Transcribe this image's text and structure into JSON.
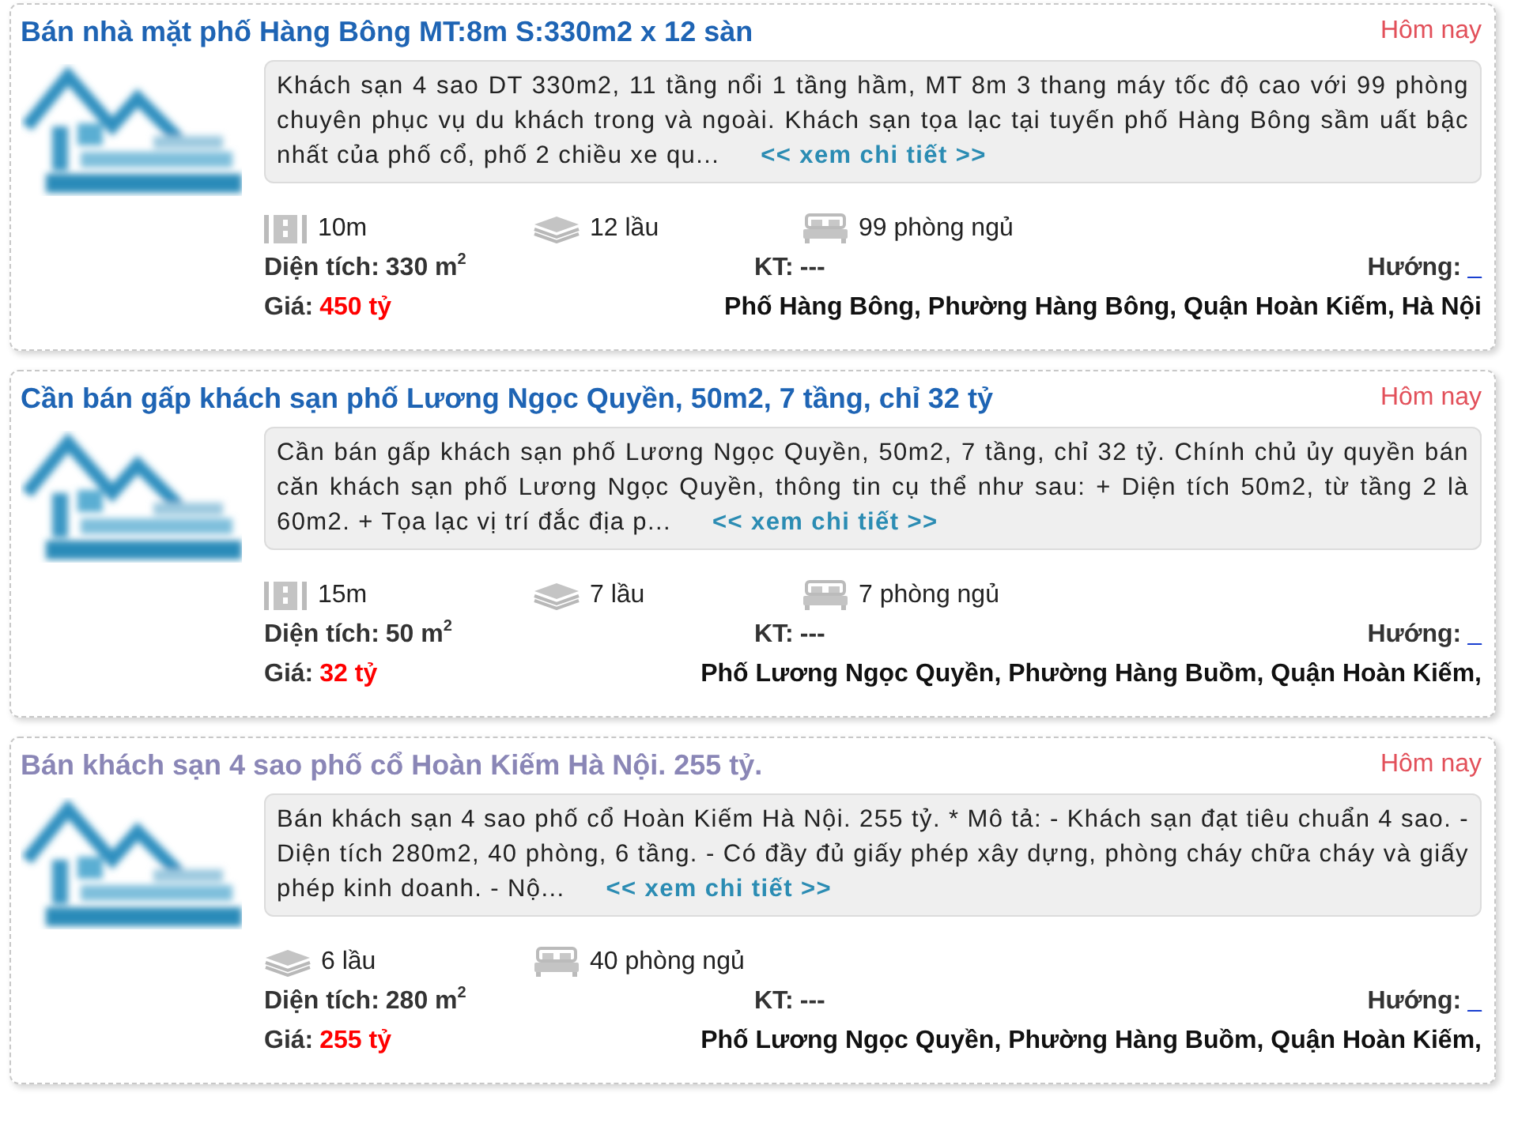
{
  "listings": [
    {
      "title": "Bán nhà mặt phố Hàng Bông MT:8m S:330m2 x 12 sàn",
      "visited": false,
      "date": "Hôm nay",
      "picture": {
        "kind": "picture"
      },
      "description": "Khách sạn 4 sao DT 330m2, 11 tầng nổi 1 tầng hầm, MT 8m 3 thang máy tốc độ cao với 99 phòng chuyên phục vụ du khách trong và ngoài. Khách sạn tọa lạc tại tuyến phố Hàng Bông sầm uất bậc nhất của phố cổ, phố 2 chiều xe qu...",
      "more_link": "<< xem chi tiết >>",
      "facts": [
        {
          "kind": "frontage",
          "text": "10m"
        },
        {
          "kind": "floors",
          "text": "12 lầu"
        },
        {
          "kind": "bedrooms",
          "text": "99 phòng ngủ"
        }
      ],
      "area_label": "Diện tích:",
      "area": "330 m$^{2}$",
      "kt_label": "KT:",
      "kt": "---",
      "direction_label": "Hướng:",
      "direction": "_",
      "price_label": "Giá:",
      "price": "450 tỷ",
      "address": "Phố Hàng Bông, Phường Hàng Bông, Quận Hoàn Kiếm, Hà Nội"
    },
    {
      "title": "Cần bán gấp khách sạn phố Lương Ngọc Quyền, 50m2, 7 tầng, chỉ 32 tỷ",
      "visited": false,
      "date": "Hôm nay",
      "picture": {
        "kind": "picture"
      },
      "description": "Cần bán gấp khách sạn phố Lương Ngọc Quyền, 50m2, 7 tầng, chỉ 32 tỷ. Chính chủ ủy quyền bán căn khách sạn phố Lương Ngọc Quyền, thông tin cụ thể như sau: + Diện tích 50m2, từ tầng 2 là 60m2. + Tọa lạc vị trí đắc địa p...",
      "more_link": "<< xem chi tiết >>",
      "facts": [
        {
          "kind": "frontage",
          "text": "15m"
        },
        {
          "kind": "floors",
          "text": "7 lầu"
        },
        {
          "kind": "bedrooms",
          "text": "7 phòng ngủ"
        }
      ],
      "area_label": "Diện tích:",
      "area": "50 m$^{2}$",
      "kt_label": "KT:",
      "kt": "---",
      "direction_label": "Hướng:",
      "direction": "_",
      "price_label": "Giá:",
      "price": "32 tỷ",
      "address": "Phố Lương Ngọc Quyền, Phường Hàng Buồm, Quận Hoàn Kiếm,"
    },
    {
      "title": "Bán khách sạn 4 sao phố cổ Hoàn Kiếm Hà Nội. 255 tỷ.",
      "visited": true,
      "date": "Hôm nay",
      "picture": {
        "kind": "picture"
      },
      "description": "Bán khách sạn 4 sao phố cổ Hoàn Kiếm Hà Nội. 255 tỷ. * Mô tả: - Khách sạn đạt tiêu chuẩn 4 sao. - Diện tích 280m2, 40 phòng, 6 tầng. - Có đầy đủ giấy phép xây dựng, phòng cháy chữa cháy và giấy phép kinh doanh. - Nộ...",
      "more_link": "<< xem chi tiết >>",
      "facts": [
        {
          "kind": "floors",
          "text": "6 lầu"
        },
        {
          "kind": "bedrooms",
          "text": "40 phòng ngủ"
        }
      ],
      "area_label": "Diện tích:",
      "area": "280 m$^{2}$",
      "kt_label": "KT:",
      "kt": "---",
      "direction_label": "Hướng:",
      "direction": "_",
      "price_label": "Giá:",
      "price": "255 tỷ",
      "address": "Phố Lương Ngọc Quyền, Phường Hàng Buồm, Quận Hoàn Kiếm,"
    }
  ]
}
